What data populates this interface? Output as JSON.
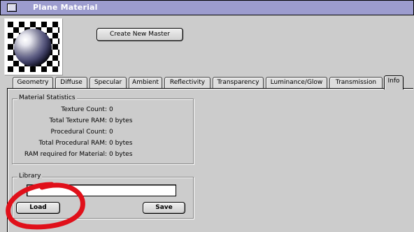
{
  "window": {
    "title": "Plane Material"
  },
  "toolbar": {
    "create_master_label": "Create New Master"
  },
  "tabs": [
    {
      "label": "Geometry",
      "active": false
    },
    {
      "label": "Diffuse",
      "active": false
    },
    {
      "label": "Specular",
      "active": false
    },
    {
      "label": "Ambient",
      "active": false
    },
    {
      "label": "Reflectivity",
      "active": false
    },
    {
      "label": "Transparency",
      "active": false
    },
    {
      "label": "Luminance/Glow",
      "active": false
    },
    {
      "label": "Transmission",
      "active": false
    },
    {
      "label": "Info",
      "active": true
    }
  ],
  "material_statistics": {
    "title": "Material Statistics",
    "rows": [
      {
        "label": "Texture Count:",
        "value": "0"
      },
      {
        "label": "Total Texture RAM:",
        "value": "0 bytes"
      },
      {
        "label": "Procedural Count:",
        "value": "0"
      },
      {
        "label": "Total Procedural RAM:",
        "value": "0 bytes"
      },
      {
        "label": "RAM required for Material:",
        "value": "0 bytes"
      }
    ]
  },
  "library": {
    "title": "Library",
    "name_value": "",
    "load_label": "Load",
    "save_label": "Save"
  },
  "colors": {
    "titlebar": "#9c9cce",
    "window_bg": "#cccccc",
    "annotation": "#e0101a"
  },
  "icons": [
    "close-box-icon",
    "material-sphere-preview"
  ]
}
